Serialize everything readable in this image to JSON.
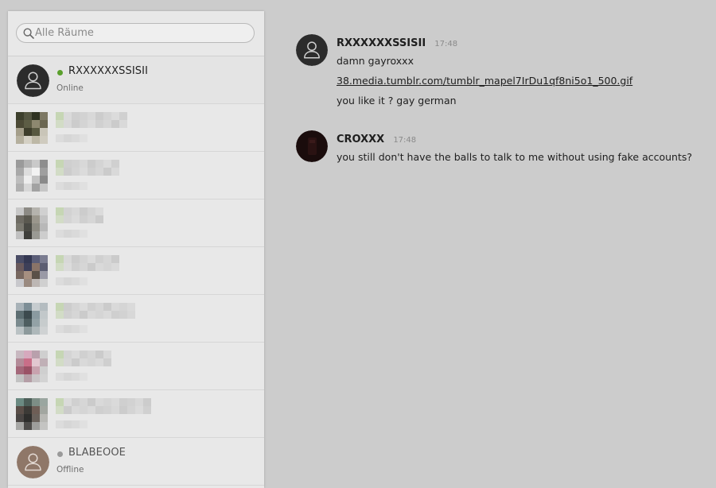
{
  "search": {
    "placeholder": "Alle Räume",
    "icon": "search-icon"
  },
  "rooms": [
    {
      "name": "RXXXXXXSSISII",
      "status": "Online",
      "status_color": "#5aa02c",
      "avatar": "user-icon"
    },
    {
      "name": "BLABEOOE",
      "status": "Offline",
      "status_color": "#9a9a9a",
      "avatar": "user-icon"
    }
  ],
  "messages": [
    {
      "author": "RXXXXXXSSISII",
      "time": "17:48",
      "avatar": "user-icon",
      "lines": [
        {
          "text": "damn gayroxxx"
        },
        {
          "text": "38.media.tumblr.com/tumblr_mapel7IrDu1qf8ni5o1_500.gif",
          "link": true
        },
        {
          "text": "you like it ? gay german"
        }
      ]
    },
    {
      "author": "CROXXX",
      "time": "17:48",
      "avatar": "dark-avatar",
      "lines": [
        {
          "text": "you still don't have the balls to talk to me without using fake accounts?"
        }
      ]
    }
  ],
  "colors": {
    "background": "#cccccc",
    "sidebar": "#e8e8e8",
    "online": "#5aa02c",
    "offline": "#9a9a9a"
  }
}
